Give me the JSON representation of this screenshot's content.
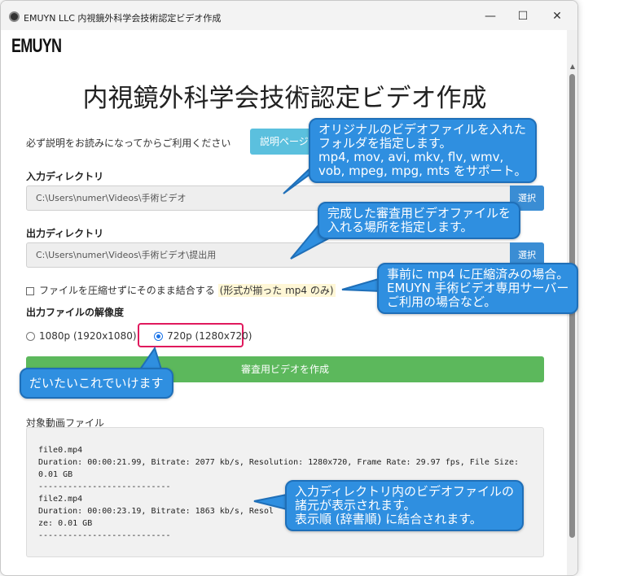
{
  "window": {
    "title": "EMUYN LLC 内視鏡外科学会技術認定ビデオ作成",
    "min": "—",
    "max": "☐",
    "close": "✕"
  },
  "logo": "EMUYN",
  "page_title": "内視鏡外科学会技術認定ビデオ作成",
  "notice": "必ず説明をお読みになってからご利用ください",
  "help_button": "説明ページ",
  "input_dir": {
    "label": "入力ディレクトリ",
    "value": "C:\\Users\\numer\\Videos\\手術ビデオ",
    "browse": "選択"
  },
  "output_dir": {
    "label": "出力ディレクトリ",
    "value": "C:\\Users\\numer\\Videos\\手術ビデオ\\提出用",
    "browse": "選択"
  },
  "concat_option": {
    "label": "ファイルを圧縮せずにそのまま結合する",
    "note": "(形式が揃った mp4 のみ)",
    "checked": false
  },
  "resolution": {
    "label": "出力ファイルの解像度",
    "options": [
      "1080p (1920x1080)",
      "720p (1280x720)"
    ],
    "selected": "720p (1280x720)"
  },
  "create_button": "審査用ビデオを作成",
  "files_section": {
    "label": "対象動画ファイル",
    "log": "file0.mp4\nDuration: 00:00:21.99, Bitrate: 2077 kb/s, Resolution: 1280x720, Frame Rate: 29.97 fps, File Size: 0.01 GB\n---------------------------\nfile2.mp4\nDuration: 00:00:23.19, Bitrate: 1863 kb/s, Resol\nze: 0.01 GB\n---------------------------"
  },
  "callouts": {
    "input_dir": [
      "オリジナルのビデオファイルを入れた",
      "フォルダを指定します。",
      "mp4, mov, avi, mkv, flv, wmv,",
      "vob, mpeg, mpg, mts をサポート。"
    ],
    "output_dir": [
      "完成した審査用ビデオファイルを",
      "入れる場所を指定します。"
    ],
    "concat": [
      "事前に mp4 に圧縮済みの場合。",
      "EMUYN 手術ビデオ専用サーバー",
      "ご利用の場合など。"
    ],
    "resolution": [
      "だいたいこれでいけます"
    ],
    "files": [
      "入力ディレクトリ内のビデオファイルの",
      "諸元が表示されます。",
      "表示順 (辞書順) に結合されます。"
    ]
  },
  "colors": {
    "info_button": "#5bc0de",
    "browse_button": "#3a8dd4",
    "create_button": "#5cb85c",
    "callout": "#2f8fe0",
    "radio_highlight": "#e0195d"
  }
}
